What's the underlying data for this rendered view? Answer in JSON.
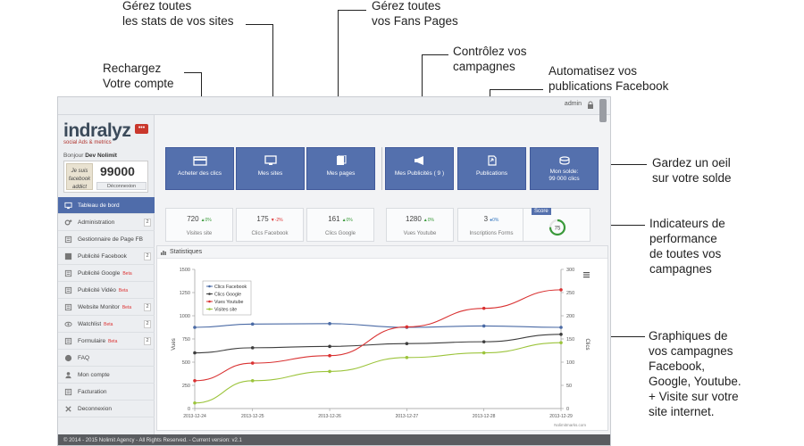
{
  "callouts": {
    "recharge": "Rechargez\nVotre compte",
    "stats": "Gérez toutes\nles stats de vos sites",
    "fans": "Gérez toutes\nvos Fans Pages",
    "campaigns": "Contrôlez vos\ncampagnes",
    "automate": "Automatisez vos\npublications Facebook",
    "balance": "Gardez un oeil\nsur votre solde",
    "indicators": "Indicateurs de\nperformance\nde toutes vos\ncampagnes",
    "charts": "Graphiques de\nvos campagnes\nFacebook,\nGoogle, Youtube.\n+ Visite sur votre\nsite internet."
  },
  "app": {
    "topbar_user": "admin",
    "logo": "indralyz",
    "logo_tagline": "social Ads & metrics",
    "greeting_prefix": "Bonjour",
    "greeting_name": "Dev Nolimit",
    "avatar_caption": "Je suis\nfacebook\naddict",
    "balance": "99000",
    "disconnect": "Déconnexion",
    "menu": [
      {
        "label": "Tableau de bord",
        "active": true,
        "icon": "monitor-icon",
        "beta": "",
        "count": ""
      },
      {
        "label": "Administration",
        "active": false,
        "icon": "gears-icon",
        "beta": "",
        "count": "2"
      },
      {
        "label": "Gestionnaire de Page FB",
        "active": false,
        "icon": "pages-icon",
        "beta": "",
        "count": ""
      },
      {
        "label": "Publicité Facebook",
        "active": false,
        "icon": "facebook-icon",
        "beta": "",
        "count": "2"
      },
      {
        "label": "Publicité Google",
        "active": false,
        "icon": "google-icon",
        "beta": "Beta",
        "count": ""
      },
      {
        "label": "Publicité Vidéo",
        "active": false,
        "icon": "youtube-icon",
        "beta": "Beta",
        "count": ""
      },
      {
        "label": "Website Monitor",
        "active": false,
        "icon": "desktop-icon",
        "beta": "Beta",
        "count": "2"
      },
      {
        "label": "Watchlist",
        "active": false,
        "icon": "eye-icon",
        "beta": "Beta",
        "count": "2"
      },
      {
        "label": "Formulaire",
        "active": false,
        "icon": "form-icon",
        "beta": "Beta",
        "count": "2"
      },
      {
        "label": "FAQ",
        "active": false,
        "icon": "help-icon",
        "beta": "",
        "count": ""
      },
      {
        "label": "Mon compte",
        "active": false,
        "icon": "user-icon",
        "beta": "",
        "count": ""
      },
      {
        "label": "Facturation",
        "active": false,
        "icon": "billing-icon",
        "beta": "",
        "count": ""
      },
      {
        "label": "Deconnexion",
        "active": false,
        "icon": "close-icon",
        "beta": "",
        "count": ""
      }
    ],
    "actions": [
      {
        "label": "Acheter des clics",
        "icon": "credit-card-icon"
      },
      {
        "label": "Mes sites",
        "icon": "monitor-icon"
      },
      {
        "label": "Mes pages",
        "icon": "files-icon"
      },
      {
        "label": "Mes Publicités ( 9 )",
        "icon": "megaphone-icon"
      },
      {
        "label": "Publications",
        "icon": "publish-icon"
      },
      {
        "label": "Mon solde:\n99 000 clics",
        "icon": "coins-icon"
      }
    ],
    "kpis": [
      {
        "value": "720",
        "change": "0%",
        "trend": "up",
        "label": "Visites site"
      },
      {
        "value": "175",
        "change": "-2%",
        "trend": "down",
        "label": "Clics Facebook"
      },
      {
        "value": "161",
        "change": "0%",
        "trend": "up",
        "label": "Clics Google"
      },
      {
        "value": "1280",
        "change": "0%",
        "trend": "up",
        "label": "Vues Youtube"
      },
      {
        "value": "3",
        "change": "0%",
        "trend": "flat",
        "label": "Inscriptions Forms"
      }
    ],
    "score": {
      "label": "Score",
      "value": "75",
      "level": 0.75
    },
    "statistics_title": "Statistiques",
    "footer": "© 2014 - 2015 Nolimit Agency - All Rights Reserved. - Current version: v2.1",
    "watermark": "Nolimitmarks.com"
  },
  "chart_data": {
    "type": "line",
    "categories": [
      "2013-12-24",
      "2013-12-25",
      "2013-12-26",
      "2013-12-27",
      "2013-12-28",
      "2013-12-29"
    ],
    "x_positions": [
      0,
      0.75,
      1.75,
      2.75,
      3.75,
      4.75
    ],
    "series": [
      {
        "name": "Clics Facebook",
        "color": "#4a6aa5",
        "axis": "right",
        "values": [
          175,
          182,
          183,
          175,
          178,
          175
        ]
      },
      {
        "name": "Clics Google",
        "color": "#3d3d3d",
        "axis": "right",
        "values": [
          120,
          131,
          134,
          140,
          144,
          160
        ]
      },
      {
        "name": "Vues Youtube",
        "color": "#d93131",
        "axis": "left",
        "values": [
          300,
          490,
          570,
          880,
          1080,
          1280
        ]
      },
      {
        "name": "Visites site",
        "color": "#9cc43b",
        "axis": "right",
        "values": [
          12,
          60,
          80,
          110,
          120,
          142
        ]
      }
    ],
    "ylabel": "Vues",
    "ylabel_right": "Clics",
    "ylim": [
      0,
      1500
    ],
    "yticks": [
      0,
      250,
      500,
      750,
      1000,
      1250,
      1500
    ],
    "ylim_right": [
      0,
      300
    ],
    "yticks_right": [
      0,
      50,
      100,
      150,
      200,
      250,
      300
    ],
    "grid": false,
    "legend": "top-left"
  },
  "colors": {
    "accent": "#5470ad",
    "footer": "#5a5c60",
    "score_ring": "#3a9a3a"
  }
}
